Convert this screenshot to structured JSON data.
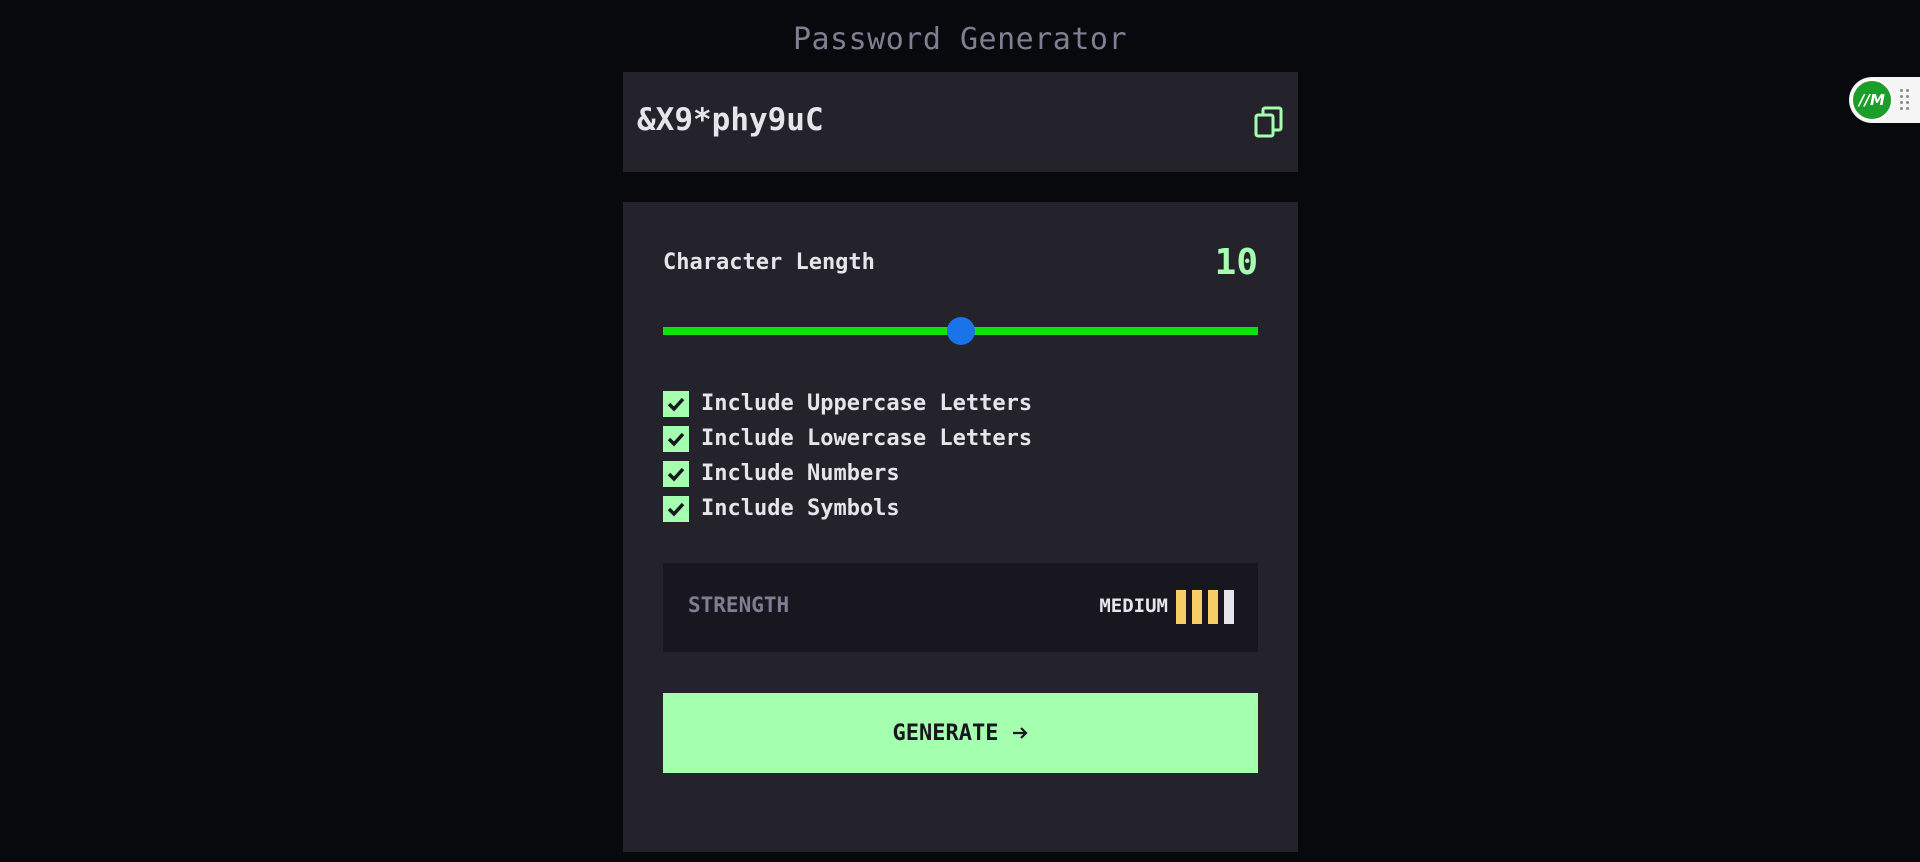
{
  "app": {
    "title": "Password Generator"
  },
  "password": {
    "value": "&X9*phy9uC",
    "copy_icon": "copy-icon"
  },
  "length": {
    "label": "Character Length",
    "value": "10",
    "slider_fraction": 0.5
  },
  "options": [
    {
      "label": "Include Uppercase Letters",
      "checked": true
    },
    {
      "label": "Include Lowercase Letters",
      "checked": true
    },
    {
      "label": "Include Numbers",
      "checked": true
    },
    {
      "label": "Include Symbols",
      "checked": true
    }
  ],
  "strength": {
    "label": "STRENGTH",
    "level": "MEDIUM",
    "bars_filled": 3,
    "bars_total": 4
  },
  "generate": {
    "label": "GENERATE",
    "icon": "arrow-right-icon"
  },
  "extension": {
    "logo_text": "//M",
    "icon": "grip-icon"
  },
  "colors": {
    "background": "#08090d",
    "panel": "#24232c",
    "accent": "#a4ffaf",
    "slider_fill": "#10e010",
    "slider_thumb": "#1a73e8",
    "strength_bar": "#f8cd65",
    "strength_bar_empty": "#e6e5ea",
    "muted": "#817d92"
  }
}
